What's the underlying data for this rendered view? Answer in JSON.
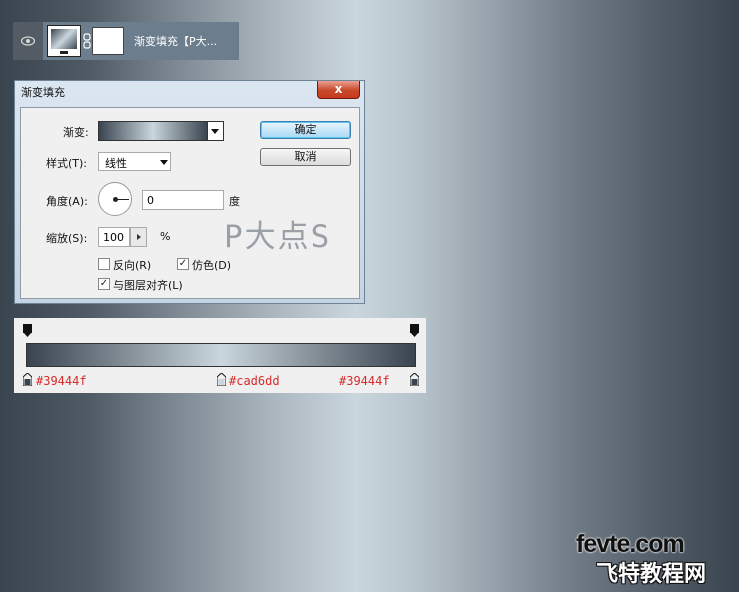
{
  "layer": {
    "name": "渐变填充【P大..."
  },
  "dialog": {
    "title": "渐变填充",
    "close_label": "x",
    "gradient_label": "渐变:",
    "style_label": "样式(T):",
    "style_value": "线性",
    "angle_label": "角度(A):",
    "angle_value": "0",
    "angle_unit": "度",
    "scale_label": "缩放(S):",
    "scale_value": "100",
    "scale_unit": "%",
    "reverse_label": "反向(R)",
    "reverse_checked": false,
    "dither_label": "仿色(D)",
    "dither_checked": true,
    "align_label": "与图层对齐(L)",
    "align_checked": true,
    "ok_label": "确定",
    "cancel_label": "取消",
    "watermark": "P大点S"
  },
  "gradient_editor": {
    "stops": [
      {
        "color": "#39444f",
        "label": "#39444f"
      },
      {
        "color": "#cad6dd",
        "label": "#cad6dd"
      },
      {
        "color": "#39444f",
        "label": "#39444f"
      }
    ]
  },
  "site_logo": {
    "top": "fevte.com",
    "bottom": "飞特教程网"
  }
}
